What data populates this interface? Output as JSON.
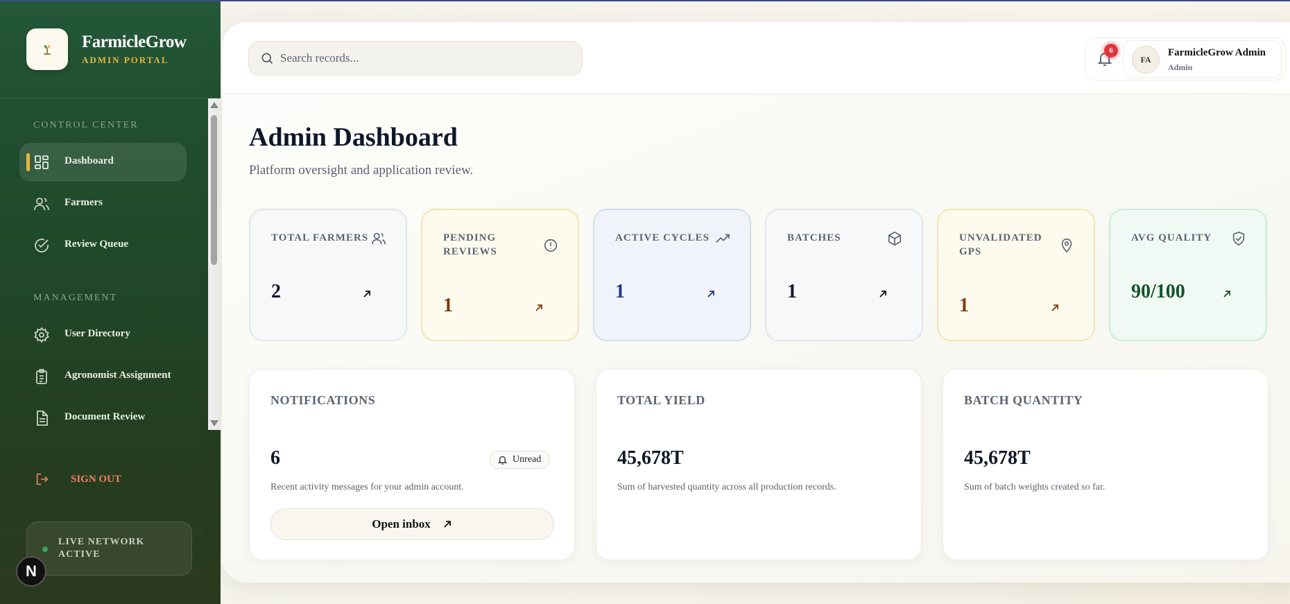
{
  "brand": {
    "name": "FarmicleGrow",
    "subtitle": "ADMIN PORTAL"
  },
  "sidebar": {
    "sections": [
      {
        "label": "CONTROL CENTER"
      },
      {
        "label": "MANAGEMENT"
      }
    ],
    "items": [
      {
        "label": "Dashboard",
        "icon": "grid-icon",
        "active": true
      },
      {
        "label": "Farmers",
        "icon": "users-icon"
      },
      {
        "label": "Review Queue",
        "icon": "check-circle-icon"
      },
      {
        "label": "User Directory",
        "icon": "gear-icon"
      },
      {
        "label": "Agronomist Assignment",
        "icon": "clipboard-icon"
      },
      {
        "label": "Document Review",
        "icon": "document-icon"
      }
    ],
    "signout_label": "SIGN OUT",
    "live_label": "LIVE NETWORK ACTIVE",
    "dev_badge": "N"
  },
  "header": {
    "search_placeholder": "Search records...",
    "notification_count": "6",
    "user": {
      "initials": "FA",
      "name": "FarmicleGrow Admin",
      "role": "Admin"
    }
  },
  "page": {
    "title": "Admin Dashboard",
    "subtitle": "Platform oversight and application review."
  },
  "stats": [
    {
      "label": "TOTAL FARMERS",
      "value": "2",
      "icon": "users-icon",
      "tone": "neutral"
    },
    {
      "label": "PENDING REVIEWS",
      "value": "1",
      "icon": "alert-circle-icon",
      "tone": "amber"
    },
    {
      "label": "ACTIVE CYCLES",
      "value": "1",
      "icon": "trending-up-icon",
      "tone": "blue"
    },
    {
      "label": "BATCHES",
      "value": "1",
      "icon": "box-icon",
      "tone": "neutral"
    },
    {
      "label": "UNVALIDATED GPS",
      "value": "1",
      "icon": "map-pin-icon",
      "tone": "amber"
    },
    {
      "label": "AVG QUALITY",
      "value": "90/100",
      "icon": "shield-check-icon",
      "tone": "green"
    }
  ],
  "cards": {
    "notifications": {
      "label": "NOTIFICATIONS",
      "value": "6",
      "pill": "Unread",
      "desc": "Recent activity messages for your admin account.",
      "button": "Open inbox"
    },
    "yield": {
      "label": "TOTAL YIELD",
      "value": "45,678T",
      "desc": "Sum of harvested quantity across all production records."
    },
    "batch": {
      "label": "BATCH QUANTITY",
      "value": "45,678T",
      "desc": "Sum of batch weights created so far."
    }
  },
  "colors": {
    "sidebar": "#21502f",
    "accent": "#e8b63b",
    "signout": "#f08060",
    "badge": "#e0353d",
    "amber_value": "#7a3b0e",
    "blue_value": "#1e3a8a",
    "green_value": "#14532d"
  }
}
